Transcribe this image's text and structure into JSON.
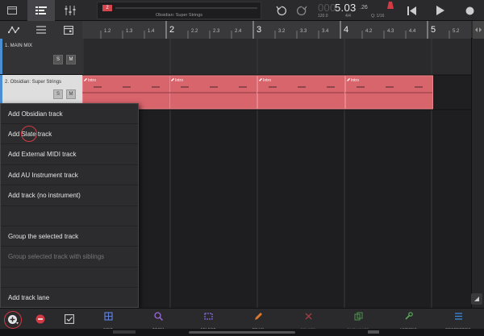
{
  "toolbar": {
    "song_name": "Obsidian: Super Strings",
    "position_marker": "2",
    "time_dim": "000",
    "time_main": "5.03",
    "time_ticks": ".26",
    "tempo": "120.0",
    "time_signature": "4/4",
    "quantize": "Q: 1/16"
  },
  "ruler": {
    "bars": [
      "1.2",
      "1.3",
      "1.4",
      "2",
      "2.2",
      "2.3",
      "2.4",
      "3",
      "3.2",
      "3.3",
      "3.4",
      "4",
      "4.2",
      "4.3",
      "4.4",
      "5",
      "5.2"
    ]
  },
  "tracks": [
    {
      "name": "1. MAIN MIX",
      "solo": "S",
      "mute": "M",
      "color": "#4a8fd4"
    },
    {
      "name": "2. Obsidian: Super Strings",
      "solo": "S",
      "mute": "M",
      "color": "#4a8fd4"
    }
  ],
  "clips": {
    "label": "Intro",
    "color": "#d8646c",
    "border_color": "#e8858c"
  },
  "add_menu": {
    "items": [
      {
        "label": "Add Obsidian track",
        "enabled": true
      },
      {
        "label": "Add Slate track",
        "enabled": true
      },
      {
        "label": "Add External MIDI track",
        "enabled": true
      },
      {
        "label": "Add AU Instrument track",
        "enabled": true
      },
      {
        "label": "Add track (no instrument)",
        "enabled": true
      },
      {
        "label": "",
        "enabled": true
      },
      {
        "label": "Group the selected track",
        "enabled": true
      },
      {
        "label": "Group selected track with siblings",
        "enabled": false
      },
      {
        "label": "",
        "enabled": true
      },
      {
        "label": "Add track lane",
        "enabled": true
      }
    ]
  },
  "bottom_tools": [
    {
      "label": "GRID",
      "icon": "grid-icon",
      "color": "#5b7fd8",
      "enabled": true
    },
    {
      "label": "ZOOM",
      "icon": "zoom-icon",
      "color": "#9a6ad8",
      "enabled": true
    },
    {
      "label": "SELECT",
      "icon": "select-icon",
      "color": "#8a6ae0",
      "enabled": true
    },
    {
      "label": "DRAW",
      "icon": "draw-icon",
      "color": "#e0782e",
      "enabled": true
    },
    {
      "label": "DELETE",
      "icon": "delete-icon",
      "color": "#a03a40",
      "enabled": false
    },
    {
      "label": "DUPLICATE",
      "icon": "duplicate-icon",
      "color": "#4e8a4e",
      "enabled": false
    },
    {
      "label": "ACTIONS",
      "icon": "actions-icon",
      "color": "#5aa85a",
      "enabled": true
    },
    {
      "label": "PROPERTIES",
      "icon": "properties-icon",
      "color": "#3e8ad8",
      "enabled": true
    }
  ],
  "colors": {
    "accent_red": "#d23b43",
    "track_blue": "#4a8fd4"
  }
}
